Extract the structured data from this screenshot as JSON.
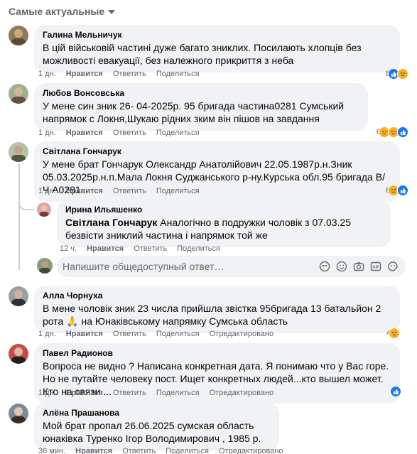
{
  "sort_label": "Самые актуальные",
  "reply_placeholder": "Напишите общедоступный ответ…",
  "actions": {
    "like": "Нравится",
    "reply": "Ответить",
    "share": "Поделиться",
    "edited": "Отредактировано"
  },
  "comments": [
    {
      "author": "Галина Мельничук",
      "text": "В цій військовій частині дуже багато зниклих. Посилають хлопців без можливості евакуації, без належного прикриття з неба",
      "time": "1 дн.",
      "count": "8",
      "reactions": [
        "like-icon",
        "sad-icon"
      ]
    },
    {
      "author": "Любов Вонсовська",
      "text": "У мене син зник 26- 04-2025р. 95 бригада частина0281 Сумський напрямок с Локня,Шукаю рідних зким він пішов на завдання",
      "time": "1 дн.",
      "count": "6",
      "reactions": [
        "sad-icon",
        "cry-icon",
        "like-icon"
      ]
    },
    {
      "author": "Світлана Гончарук",
      "text": "У мене брат Гончарук Олександр Анатолійович 22.05.1987р.н.Зник 05.03.2025р.н.п.Мала Локня Суджанського р-ну.Курська обл.95 бригада В/Ч А0281",
      "time": "1 дн.",
      "count": "6",
      "reactions": [
        "sad-icon",
        "like-icon"
      ]
    },
    {
      "author": "Ирина Ильяшенко",
      "mention": "Світлана Гончарук",
      "text": " Аналогічно в подружки чоловік з 07.03.25 безвісти зниклий частина і напрямок той же",
      "time": "12 ч."
    },
    {
      "author": "Алла Чорнуха",
      "text": "В мене чоловік зник 23 числа прийшла звістка 95бригада 13 батальйон 2 рота 🙏 на Юнаківському напрямку Сумська область",
      "time": "1 дн.",
      "count": "4",
      "reactions": [
        "sad-icon"
      ]
    },
    {
      "author": "Павел Радионов",
      "text": "Вопроса не видно ? Написана конкретная дата. Я понимаю что у Вас горе. Но не путайте человеку пост. Ищет конкретных людей...кто вышел может. Кто на связи ...",
      "time": "1 дн.",
      "reactions": [
        "like-icon"
      ]
    },
    {
      "author": "Алёна Прашанова",
      "text": "Мой брат пропал 26.06.2025 сумская область юнаківка Туренко Ігор Володимирович , 1985 р.",
      "time": "36 мин."
    }
  ],
  "colors": {
    "bubble": "#f0f2f5",
    "meta": "#65676b",
    "like": "#1877f2",
    "sad": "#f7b125"
  }
}
